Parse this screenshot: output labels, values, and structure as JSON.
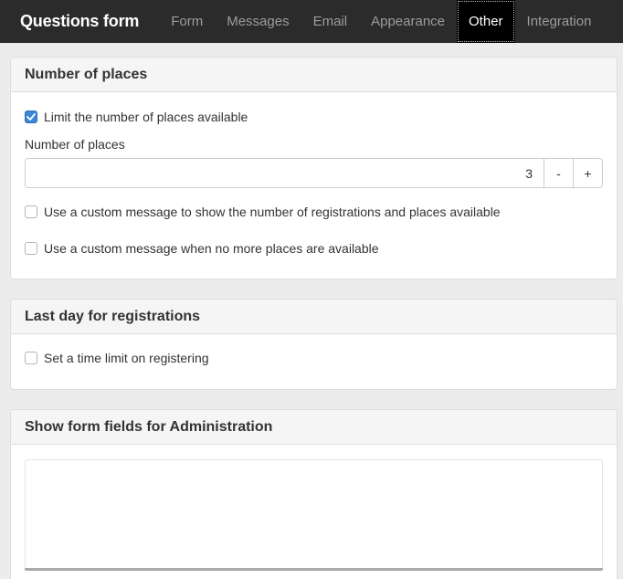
{
  "navbar": {
    "brand": "Questions form",
    "tabs": [
      {
        "label": "Form",
        "active": false
      },
      {
        "label": "Messages",
        "active": false
      },
      {
        "label": "Email",
        "active": false
      },
      {
        "label": "Appearance",
        "active": false
      },
      {
        "label": "Other",
        "active": true
      },
      {
        "label": "Integration",
        "active": false
      }
    ]
  },
  "places_panel": {
    "title": "Number of places",
    "limit_checkbox": {
      "label": "Limit the number of places available",
      "checked": true
    },
    "number_label": "Number of places",
    "number_value": "3",
    "minus_label": "-",
    "plus_label": "+",
    "custom_message_checkbox": {
      "label": "Use a custom message to show the number of registrations and places available",
      "checked": false
    },
    "no_places_checkbox": {
      "label": "Use a custom message when no more places are available",
      "checked": false
    }
  },
  "deadline_panel": {
    "title": "Last day for registrations",
    "time_limit_checkbox": {
      "label": "Set a time limit on registering",
      "checked": false
    }
  },
  "admin_panel": {
    "title": "Show form fields for Administration",
    "textarea_value": ""
  },
  "colors": {
    "navbar_bg": "#2b2b2b",
    "active_tab_bg": "#000000",
    "checkbox_accent": "#3a87d4",
    "page_bg": "#ececec"
  }
}
